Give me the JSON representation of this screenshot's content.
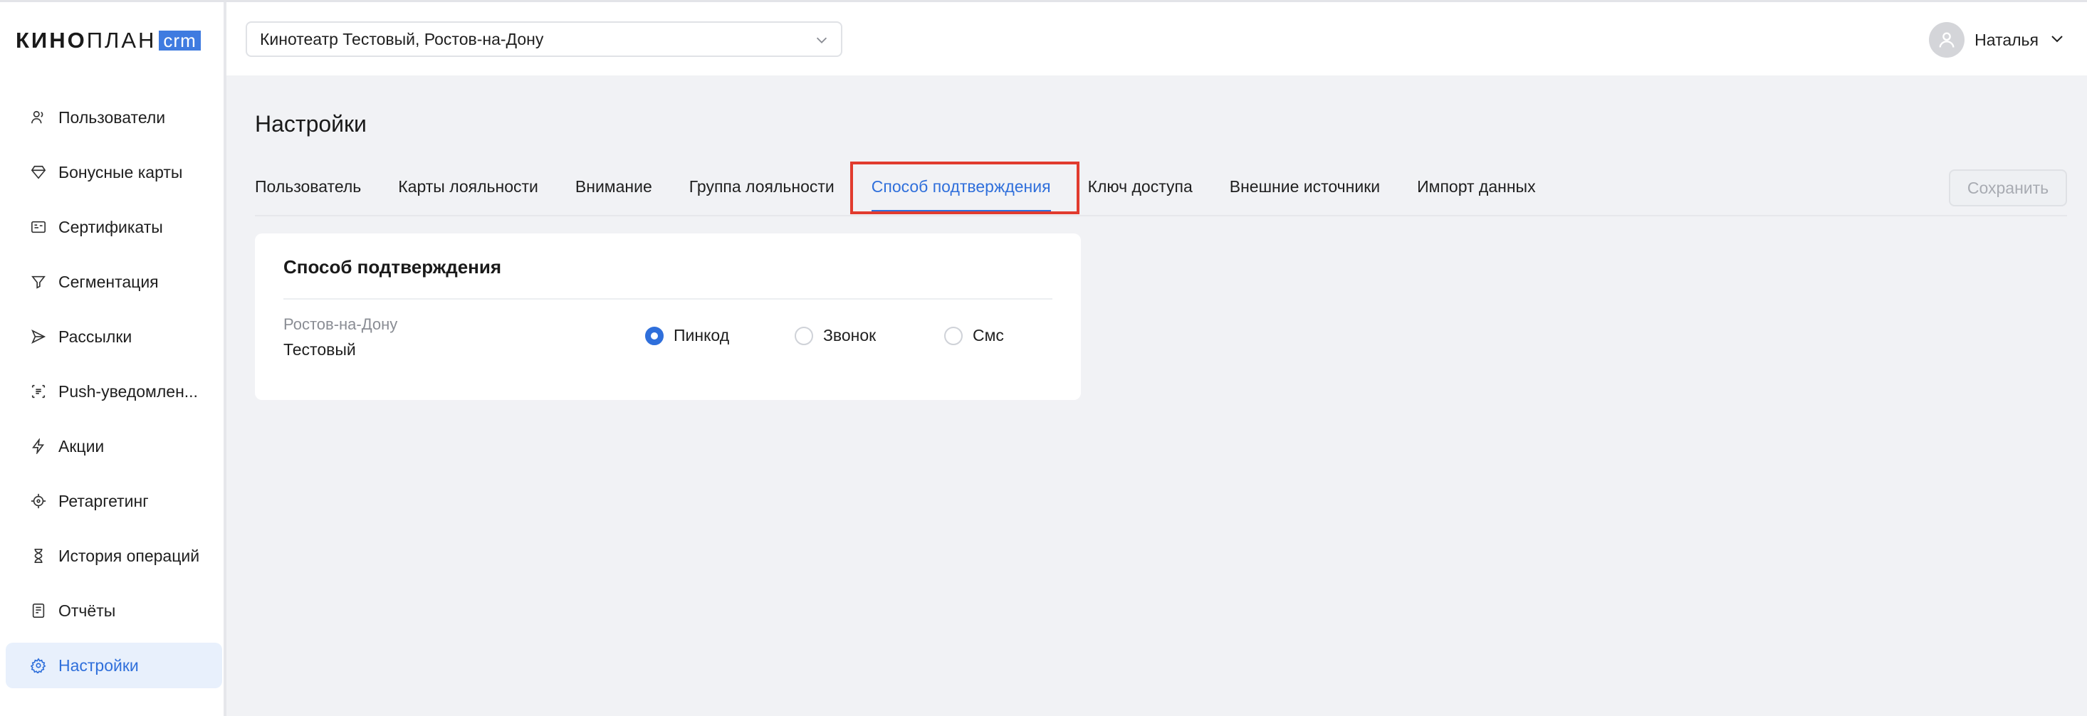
{
  "brand": {
    "kino": "КИНО",
    "plan": "ПЛАН",
    "crm": "crm",
    "accent": "#3f7be0"
  },
  "sidebar": {
    "items": [
      {
        "label": "Пользователи",
        "icon": "users-icon"
      },
      {
        "label": "Бонусные карты",
        "icon": "diamond-icon"
      },
      {
        "label": "Сертификаты",
        "icon": "certificate-icon"
      },
      {
        "label": "Сегментация",
        "icon": "filter-icon"
      },
      {
        "label": "Рассылки",
        "icon": "send-icon"
      },
      {
        "label": "Push-уведомлен...",
        "icon": "push-icon"
      },
      {
        "label": "Акции",
        "icon": "lightning-icon"
      },
      {
        "label": "Ретаргетинг",
        "icon": "target-icon"
      },
      {
        "label": "История операций",
        "icon": "hourglass-icon"
      },
      {
        "label": "Отчёты",
        "icon": "report-icon"
      },
      {
        "label": "Настройки",
        "icon": "gear-icon",
        "active": true
      }
    ]
  },
  "header": {
    "venue": "Кинотеатр Тестовый, Ростов-на-Дону",
    "user_name": "Наталья"
  },
  "main": {
    "title": "Настройки",
    "tabs": [
      {
        "label": "Пользователь"
      },
      {
        "label": "Карты лояльности"
      },
      {
        "label": "Внимание"
      },
      {
        "label": "Группа лояльности"
      },
      {
        "label": "Способ подтверждения",
        "active": true
      },
      {
        "label": "Ключ доступа"
      },
      {
        "label": "Внешние источники"
      },
      {
        "label": "Импорт данных"
      }
    ],
    "save_label": "Сохранить",
    "card": {
      "title": "Способ подтверждения",
      "city": "Ростов-на-Дону",
      "cinema": "Тестовый",
      "options": [
        {
          "label": "Пинкод",
          "checked": true
        },
        {
          "label": "Звонок",
          "checked": false
        },
        {
          "label": "Смс",
          "checked": false
        }
      ]
    }
  },
  "colors": {
    "primary": "#2f6fdb",
    "highlight": "#e13b2e"
  }
}
